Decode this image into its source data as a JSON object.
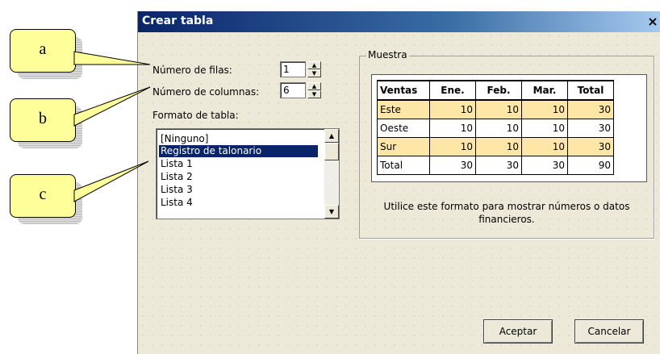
{
  "dialog": {
    "title": "Crear tabla",
    "close_label": "×",
    "rows_label": "Número de filas:",
    "rows_value": "1",
    "cols_label": "Número de columnas:",
    "cols_value": "6",
    "format_label": "Formato de tabla:",
    "format_items": [
      "[Ninguno]",
      "Registro de talonario",
      "Lista 1",
      "Lista 2",
      "Lista 3",
      "Lista 4"
    ],
    "selected_format": "Registro de talonario",
    "sample_group_label": "Muestra",
    "sample_table": {
      "headers": [
        "Ventas",
        "Ene.",
        "Feb.",
        "Mar.",
        "Total"
      ],
      "rows": [
        [
          "Este",
          "10",
          "10",
          "10",
          "30"
        ],
        [
          "Oeste",
          "10",
          "10",
          "10",
          "30"
        ],
        [
          "Sur",
          "10",
          "10",
          "10",
          "30"
        ],
        [
          "Total",
          "30",
          "30",
          "30",
          "90"
        ]
      ],
      "highlight_color": "#fde6a6"
    },
    "description": "Utilice este formato para mostrar números o datos financieros.",
    "ok_label": "Aceptar",
    "cancel_label": "Cancelar"
  },
  "callouts": [
    "a",
    "b",
    "c"
  ],
  "colors": {
    "titlebar": "#0a246a",
    "callout_fill": "#ffff99",
    "dialog_bg": "#ece9d8"
  }
}
